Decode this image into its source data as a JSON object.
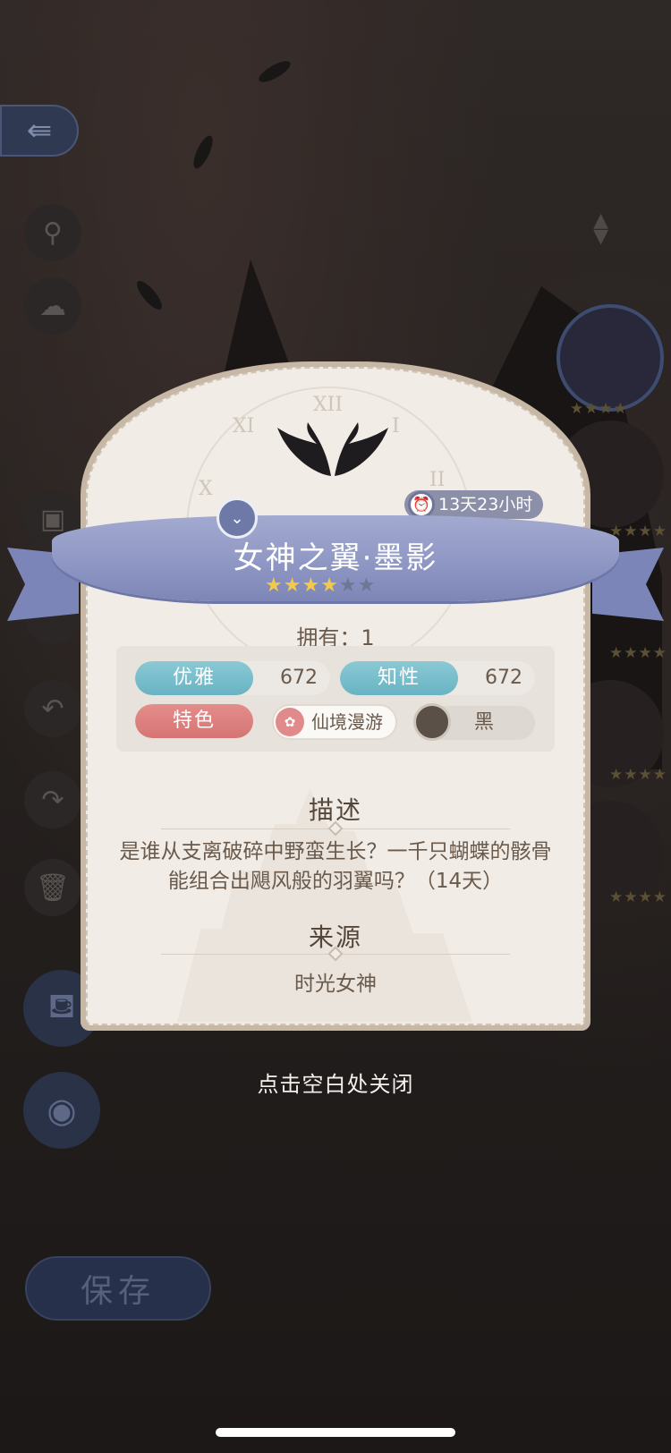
{
  "background": {
    "save_label": "保存",
    "right_panel_stars": [
      "★★★★",
      "★★★★",
      "★★★★",
      "★★★★",
      "★★★★"
    ]
  },
  "item": {
    "name": "女神之翼·墨影",
    "rarity_stars": 4,
    "max_stars": 6,
    "timer": "13天23小时",
    "owned_label": "拥有：1",
    "attributes": [
      {
        "label": "优雅",
        "value": "672"
      },
      {
        "label": "知性",
        "value": "672"
      }
    ],
    "tag_label": "特色",
    "tag_chip": "仙境漫游",
    "color": {
      "name": "黑",
      "swatch": "#5b5048"
    },
    "description_title": "描述",
    "description": "是谁从支离破碎中野蛮生长？一千只蝴蝶的骸骨能组合出飓风般的羽翼吗？（14天）",
    "source_title": "来源",
    "source": "时光女神"
  },
  "close_hint": "点击空白处关闭",
  "colors": {
    "ribbon": "#8f97c4",
    "attribute_blue": "#69b3c3",
    "tag_red": "#d57574",
    "card_bg": "#f1ece6",
    "text": "#6a5a4c"
  }
}
